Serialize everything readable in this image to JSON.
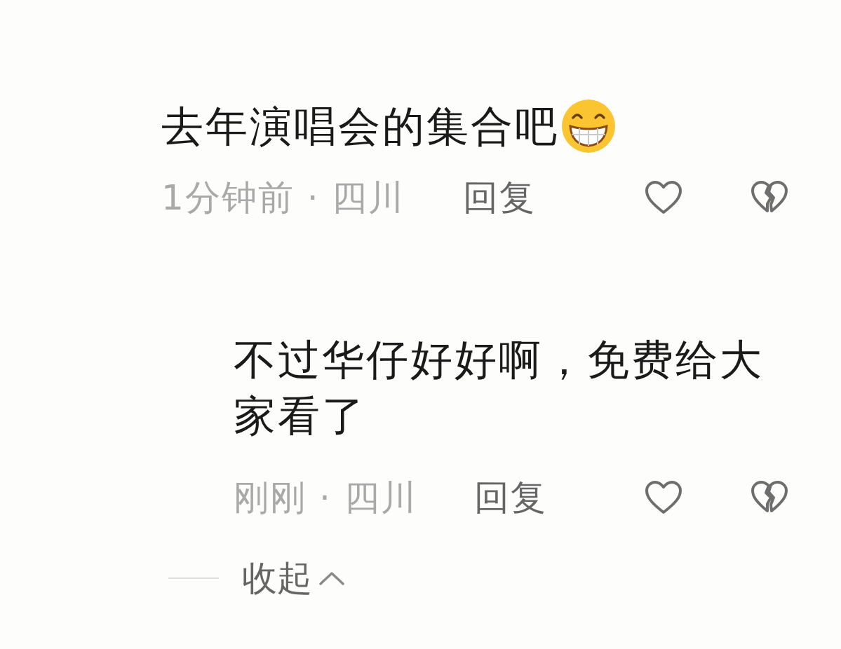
{
  "comments": [
    {
      "text": "去年演唱会的集合吧",
      "emoji": true,
      "meta": "1分钟前 · 四川",
      "reply": "回复",
      "indent": false
    },
    {
      "text": "不过华仔好好啊，免费给大家看了",
      "emoji": false,
      "meta": "刚刚 · 四川",
      "reply": "回复",
      "indent": true
    }
  ],
  "collapse": {
    "label": "收起"
  }
}
